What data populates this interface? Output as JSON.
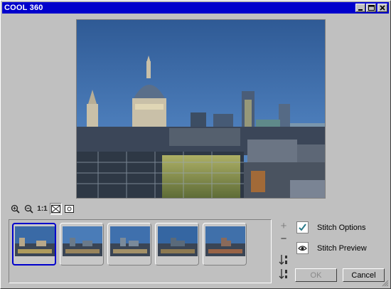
{
  "window": {
    "title": "COOL 360"
  },
  "titlebar": {
    "minimize_glyph": "_",
    "maximize_glyph": "□",
    "close_glyph": "✕"
  },
  "toolbar": {
    "zoom_in_icon": "zoom-in-icon",
    "zoom_out_icon": "zoom-out-icon",
    "actual_size_label": "1:1",
    "fit_icon": "fit-window-icon",
    "panorama_icon": "panorama-view-icon"
  },
  "thumbnails": [
    {
      "name": "thumbnail-1",
      "selected": true
    },
    {
      "name": "thumbnail-2",
      "selected": false
    },
    {
      "name": "thumbnail-3",
      "selected": false
    },
    {
      "name": "thumbnail-4",
      "selected": false
    },
    {
      "name": "thumbnail-5",
      "selected": false
    }
  ],
  "side_controls": {
    "add_glyph": "+",
    "remove_glyph": "−"
  },
  "options": {
    "stitch_options_label": "Stitch Options",
    "stitch_preview_label": "Stitch Preview"
  },
  "buttons": {
    "ok_label": "OK",
    "cancel_label": "Cancel"
  },
  "colors": {
    "titlebar": "#0000cc",
    "window_bg": "#c0c0c0",
    "selection": "#0000cc"
  }
}
